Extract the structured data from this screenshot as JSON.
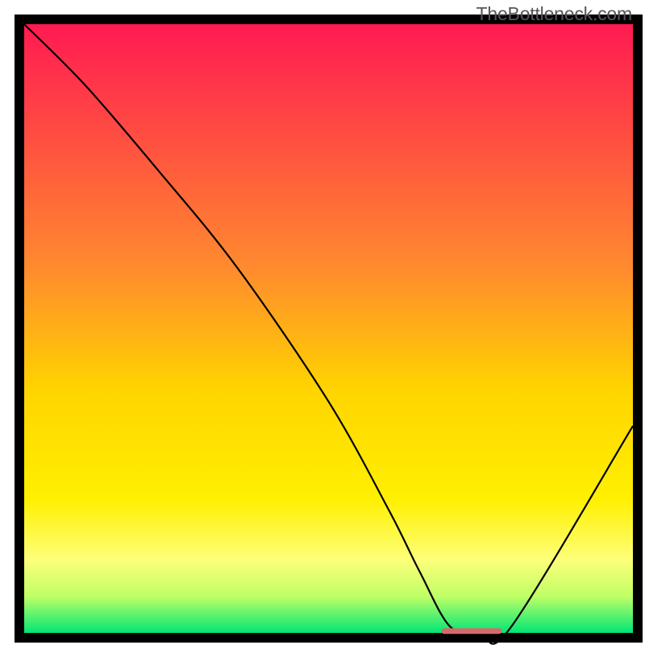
{
  "watermark": "TheBottleneck.com",
  "chart_data": {
    "type": "line",
    "title": "",
    "xlabel": "",
    "ylabel": "",
    "xlim": [
      0,
      100
    ],
    "ylim": [
      0,
      100
    ],
    "grid": false,
    "legend": false,
    "background": {
      "type": "vertical_gradient_rainbow",
      "stops": [
        {
          "offset": 0.0,
          "color": "#ff1a52"
        },
        {
          "offset": 0.4,
          "color": "#ff8a2e"
        },
        {
          "offset": 0.6,
          "color": "#ffd400"
        },
        {
          "offset": 0.78,
          "color": "#fff000"
        },
        {
          "offset": 0.88,
          "color": "#fdff7a"
        },
        {
          "offset": 0.94,
          "color": "#bfff66"
        },
        {
          "offset": 1.0,
          "color": "#00e676"
        }
      ]
    },
    "series": [
      {
        "name": "bottleneck-curve",
        "color": "#000000",
        "x": [
          0,
          10,
          22,
          35,
          50,
          60,
          65,
          70,
          75,
          80,
          100
        ],
        "y": [
          100,
          90,
          76,
          60,
          38,
          20,
          10,
          1,
          0,
          1,
          34
        ]
      }
    ],
    "marker_segment": {
      "name": "optimal_range",
      "color": "#d46a6a",
      "x_start": 69,
      "x_end": 78,
      "y": 0.3
    }
  }
}
